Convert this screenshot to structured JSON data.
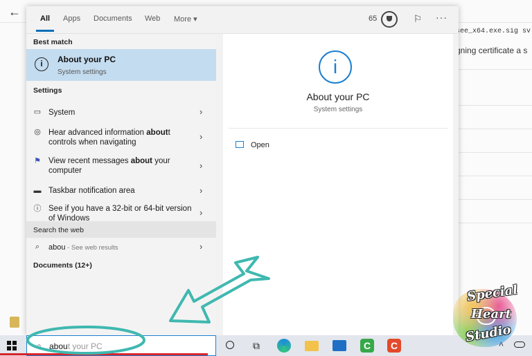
{
  "background": {
    "line_1": "see_x64.exe.sig sv",
    "line_2": "gning certificate a s"
  },
  "tabs": {
    "all": "All",
    "apps": "Apps",
    "documents": "Documents",
    "web": "Web",
    "more": "More ▾"
  },
  "header": {
    "points": "65"
  },
  "results": {
    "best_match_heading": "Best match",
    "best_match": {
      "title": "About your PC",
      "subtitle": "System settings"
    },
    "settings_heading": "Settings",
    "items": [
      {
        "pre": "System",
        "bold": "",
        "post": ""
      },
      {
        "pre": "Hear advanced information ",
        "bold": "about",
        "post": "t controls when navigating"
      },
      {
        "pre": "View recent messages ",
        "bold": "about",
        "post": " your computer"
      },
      {
        "pre": "Taskbar notification area",
        "bold": "",
        "post": ""
      },
      {
        "pre": "See if you have a 32-bit or 64-bit version of Windows",
        "bold": "",
        "post": ""
      }
    ],
    "search_web_heading": "Search the web",
    "web_item": {
      "query": "abou",
      "hint": " - See web results"
    },
    "documents_heading": "Documents (12+)"
  },
  "preview": {
    "title": "About your PC",
    "subtitle": "System settings",
    "open_label": "Open"
  },
  "taskbar": {
    "search_typed": "abou",
    "search_ghost": "t your PC"
  },
  "logo": {
    "word_1": "Special",
    "word_2": "Heart",
    "word_3": "Studio"
  },
  "colors": {
    "accent": "#1b7fd1",
    "selection": "#c4dcef",
    "annotation": "#3fb8b0"
  },
  "icons": {
    "back": "back-arrow-icon",
    "info": "info-icon",
    "system": "monitor-icon",
    "narrator": "narrator-icon",
    "flag": "flag-icon",
    "taskbar": "taskbar-icon",
    "web_search": "search-icon",
    "open": "open-window-icon"
  }
}
